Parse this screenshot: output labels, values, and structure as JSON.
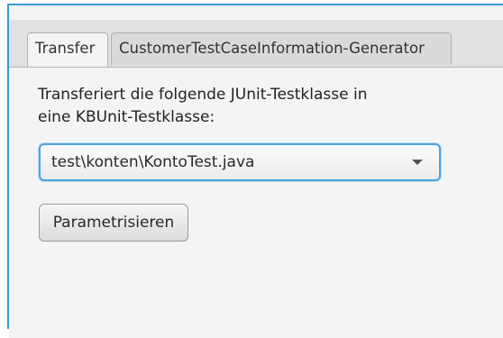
{
  "tabs": [
    {
      "label": "Transfer",
      "active": true
    },
    {
      "label": "CustomerTestCaseInformation-Generator",
      "active": false
    }
  ],
  "transfer": {
    "description_line1": "Transferiert die folgende JUnit-Testklasse in",
    "description_line2": "eine KBUnit-Testklasse:",
    "class_select": {
      "selected": "test\\konten\\KontoTest.java"
    },
    "parametrize_button": "Parametrisieren"
  },
  "colors": {
    "focus_accent": "#4aa3df",
    "frame_accent": "#3c9bd6",
    "background": "#f4f4f4"
  },
  "icons": {
    "dropdown": "chevron-down-icon"
  }
}
